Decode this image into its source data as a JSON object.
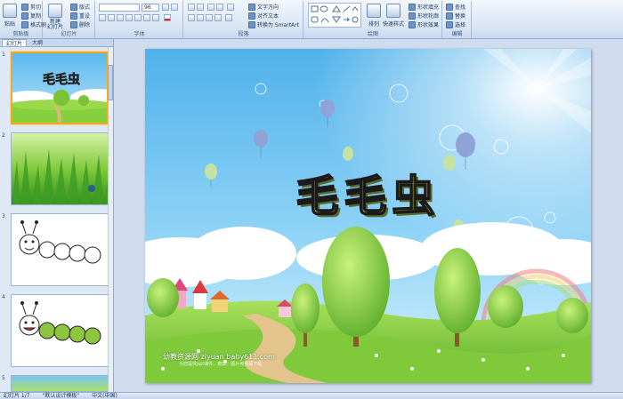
{
  "ribbon": {
    "groups": [
      {
        "id": "clipboard",
        "label": "剪贴板"
      },
      {
        "id": "slides",
        "label": "幻灯片"
      },
      {
        "id": "font",
        "label": "字体"
      },
      {
        "id": "paragraph",
        "label": "段落"
      },
      {
        "id": "drawing",
        "label": "绘图"
      },
      {
        "id": "editing",
        "label": "编辑"
      }
    ],
    "clipboard": {
      "paste": "粘贴",
      "cut": "剪切",
      "copy": "复制",
      "format_painter": "格式刷"
    },
    "slides": {
      "new_slide": "新建\n幻灯片",
      "layout": "版式",
      "reset": "重设",
      "delete": "删除"
    },
    "font": {
      "size": "96"
    },
    "paragraph": {
      "text_direction": "文字方向",
      "align_text": "对齐文本",
      "smartart": "转换为 SmartArt"
    },
    "drawing": {
      "arrange": "排列",
      "quick_styles": "快速样式",
      "shape_fill": "形状填充",
      "shape_outline": "形状轮廓",
      "shape_effects": "形状效果"
    },
    "editing": {
      "find": "查找",
      "replace": "替换",
      "select": "选择"
    }
  },
  "panel": {
    "tabs": [
      "幻灯片",
      "大纲"
    ],
    "slide_numbers": [
      "1",
      "2",
      "3",
      "4",
      "5"
    ]
  },
  "slide": {
    "title": "毛毛虫",
    "credit": "幼教资源网 ziyuan.baby611.com",
    "credit_sub": "为您提供ppt课件、教案、图片等资源下载"
  },
  "status": {
    "slide_count": "幻灯片 1/7",
    "theme": "\"默认设计模板\"",
    "language": "中文(中国)"
  },
  "colors": {
    "ribbon_bg": "#dbe6f4",
    "selection": "#f5a623",
    "title_fill": "#f7f232",
    "sky": "#6fc2f0",
    "grass": "#7cc93a"
  }
}
